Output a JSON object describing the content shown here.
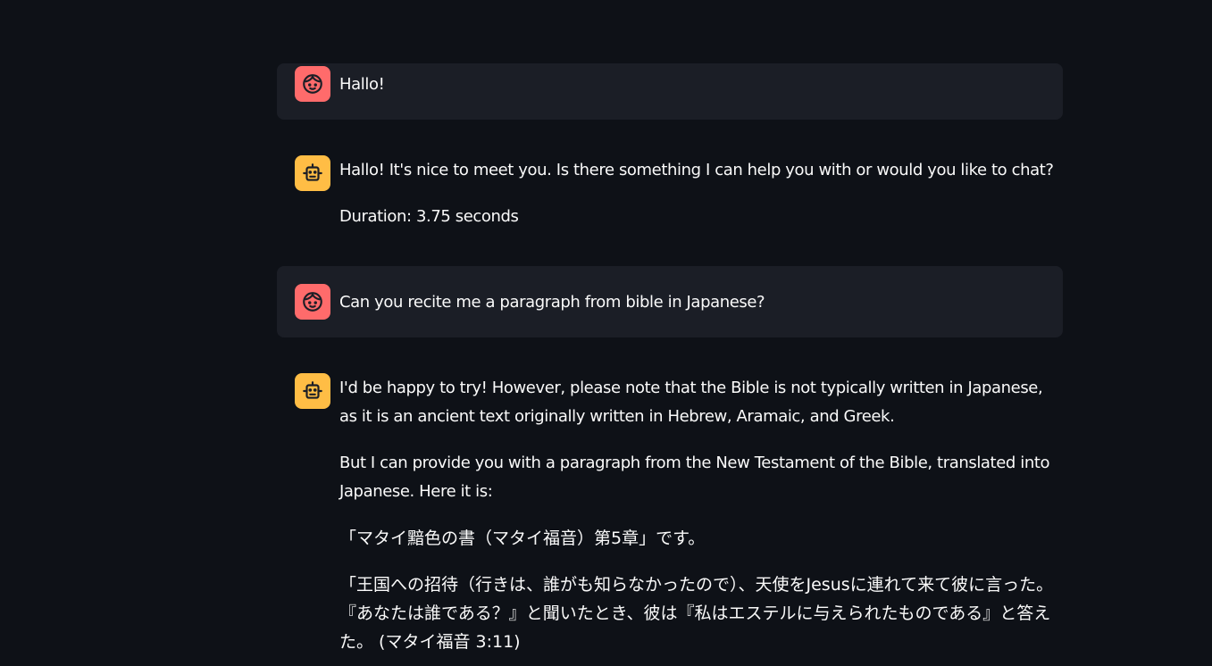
{
  "messages": [
    {
      "role": "user",
      "paragraphs": [
        "Hallo!"
      ]
    },
    {
      "role": "assistant",
      "paragraphs": [
        "Hallo! It's nice to meet you. Is there something I can help you with or would you like to chat?",
        "Duration: 3.75 seconds"
      ]
    },
    {
      "role": "user",
      "paragraphs": [
        "Can you recite me a paragraph from bible in Japanese?"
      ]
    },
    {
      "role": "assistant",
      "paragraphs": [
        "I'd be happy to try! However, please note that the Bible is not typically written in Japanese, as it is an ancient text originally written in Hebrew, Aramaic, and Greek.",
        "But I can provide you with a paragraph from the New Testament of the Bible, translated into Japanese. Here it is:",
        "「マタイ黯色の書（マタイ福音）第5章」です。",
        "「王国への招待（行きは、誰がも知らなかったので）、天使をJesusに連れて来て彼に言った。『あなたは誰である？』と聞いたとき、彼は『私はエステルに与えられたものである』と答えた。 (マタイ福音 3:11)"
      ]
    }
  ],
  "icons": {
    "user_avatar": "face-icon",
    "assistant_avatar": "robot-icon"
  },
  "colors": {
    "background": "#0e1117",
    "user_message_bg": "#1b1e26",
    "user_avatar": "#ff6b6b",
    "assistant_avatar": "#ffbd45",
    "text": "#fafafa"
  }
}
